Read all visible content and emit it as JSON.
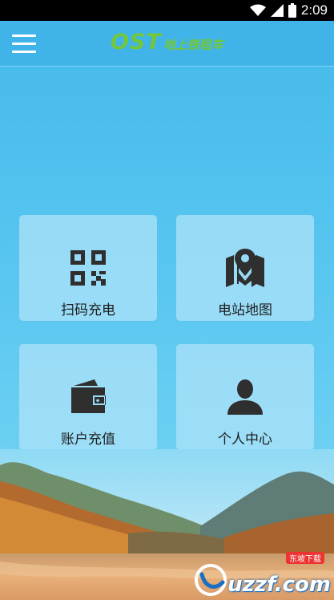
{
  "status_bar": {
    "time": "2:09"
  },
  "header": {
    "logo_mark": "OST",
    "logo_cn": "地上铁租车"
  },
  "tiles": [
    {
      "label": "扫码充电",
      "icon": "qr-code-icon"
    },
    {
      "label": "电站地图",
      "icon": "map-pin-icon"
    },
    {
      "label": "账户充值",
      "icon": "wallet-icon"
    },
    {
      "label": "个人中心",
      "icon": "user-icon"
    }
  ],
  "watermark": {
    "text": "uzzf.com",
    "tag": "东坡下载"
  },
  "colors": {
    "primary": "#43b8ea",
    "logo_green": "#72c73a",
    "tile_bg": "#aae2f8",
    "icon": "#2f2f2f"
  }
}
